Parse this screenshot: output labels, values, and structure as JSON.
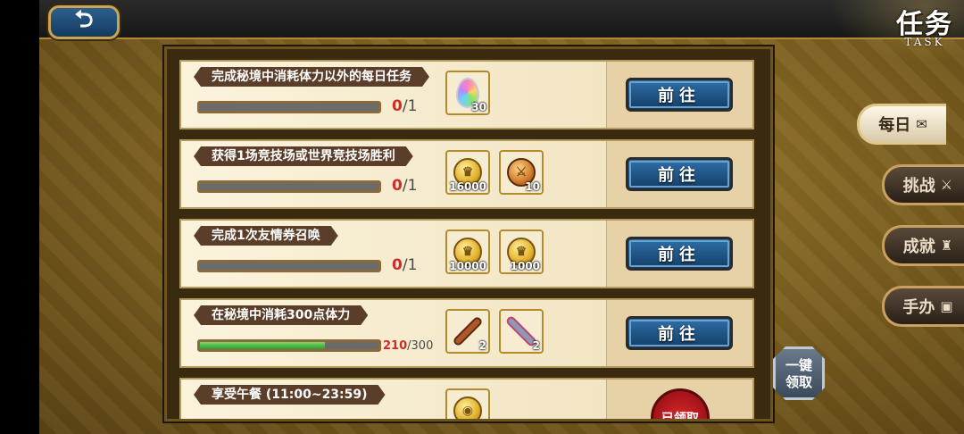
{
  "header": {
    "back_icon": "undo-arrow-icon",
    "title_cn": "任务",
    "title_en": "TASK"
  },
  "tabs": [
    {
      "label": "每日",
      "icon": "scroll-icon",
      "active": true
    },
    {
      "label": "挑战",
      "icon": "crossed-swords-icon",
      "active": false
    },
    {
      "label": "成就",
      "icon": "trophy-icon",
      "active": false
    },
    {
      "label": "手办",
      "icon": "figure-box-icon",
      "active": false
    }
  ],
  "tasks": [
    {
      "name": "完成秘境中消耗体力以外的每日任务",
      "current": "0",
      "total": "/1",
      "progress": 0,
      "rewards": [
        {
          "icon": "rainbow-gem-icon",
          "qty": "30"
        }
      ],
      "action": "前往"
    },
    {
      "name": "获得1场竞技场或世界竞技场胜利",
      "current": "0",
      "total": "/1",
      "progress": 0,
      "rewards": [
        {
          "icon": "gold-coin-icon",
          "qty": "16000"
        },
        {
          "icon": "arena-medal-icon",
          "qty": "10"
        }
      ],
      "action": "前往"
    },
    {
      "name": "完成1次友情券召唤",
      "current": "0",
      "total": "/1",
      "progress": 0,
      "rewards": [
        {
          "icon": "gold-coin-icon",
          "qty": "10000"
        },
        {
          "icon": "gold-coin-icon",
          "qty": "1000"
        }
      ],
      "action": "前往"
    },
    {
      "name": "在秘境中消耗300点体力",
      "current": "210",
      "total": "/300",
      "progress": 0.7,
      "rewards": [
        {
          "icon": "scepter-icon",
          "qty": "2"
        },
        {
          "icon": "sword-icon",
          "qty": "2"
        }
      ],
      "action": "前往"
    },
    {
      "name": "享受午餐 (11:00~23:59)",
      "current": "",
      "total": "",
      "progress": 0,
      "rewards": [
        {
          "icon": "food-icon",
          "qty": ""
        }
      ],
      "action": "",
      "stamp": "已领取"
    }
  ],
  "claim_all": {
    "line1": "一键",
    "line2": "领取"
  }
}
